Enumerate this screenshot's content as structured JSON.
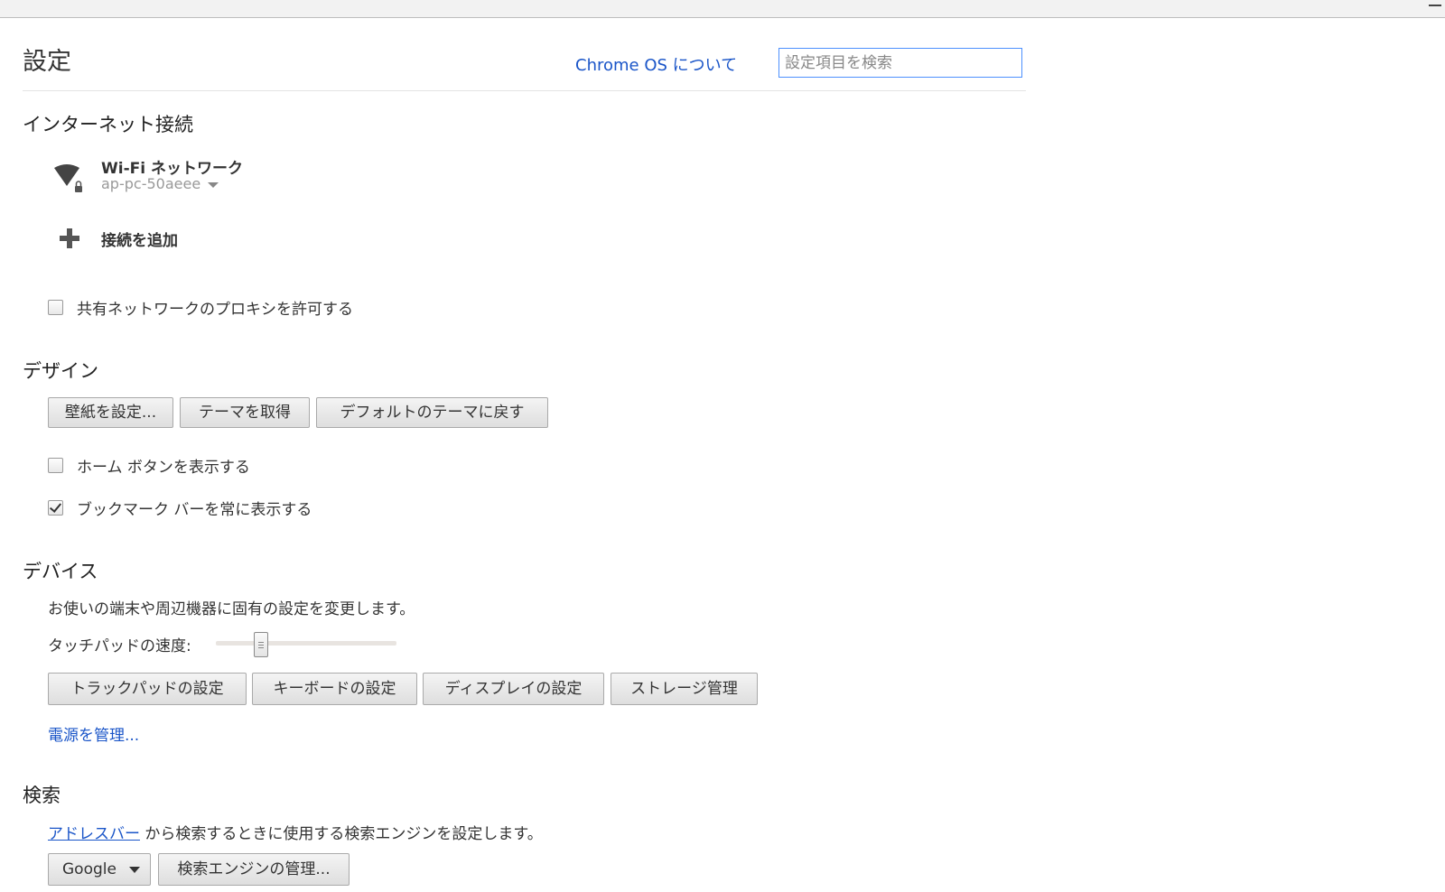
{
  "window": {
    "minimize_glyph": "–"
  },
  "header": {
    "title": "設定",
    "about_link": "Chrome OS について",
    "search_placeholder": "設定項目を検索"
  },
  "internet": {
    "title": "インターネット接続",
    "network_type": "Wi-Fi ネットワーク",
    "network_ssid": "ap-pc-50aeee",
    "add_connection": "接続を追加",
    "proxy_checkbox_label": "共有ネットワークのプロキシを許可する",
    "proxy_checked": false
  },
  "design": {
    "title": "デザイン",
    "buttons": [
      "壁紙を設定...",
      "テーマを取得",
      "デフォルトのテーマに戻す"
    ],
    "home_button_label": "ホーム ボタンを表示する",
    "home_button_checked": false,
    "bookmark_bar_label": "ブックマーク バーを常に表示する",
    "bookmark_bar_checked": true
  },
  "device": {
    "title": "デバイス",
    "description": "お使いの端末や周辺機器に固有の設定を変更します。",
    "touchpad_label": "タッチパッドの速度:",
    "touchpad_speed_fraction": 0.25,
    "buttons": [
      "トラックパッドの設定",
      "キーボードの設定",
      "ディスプレイの設定",
      "ストレージ管理"
    ],
    "power_link": "電源を管理..."
  },
  "search": {
    "title": "検索",
    "address_bar_link": "アドレスバー",
    "description_suffix": " から検索するときに使用する検索エンジンを設定します。",
    "engine_selected": "Google",
    "manage_button": "検索エンジンの管理..."
  },
  "colors": {
    "link": "#1a55c8",
    "focus_border": "#4d90fe"
  }
}
